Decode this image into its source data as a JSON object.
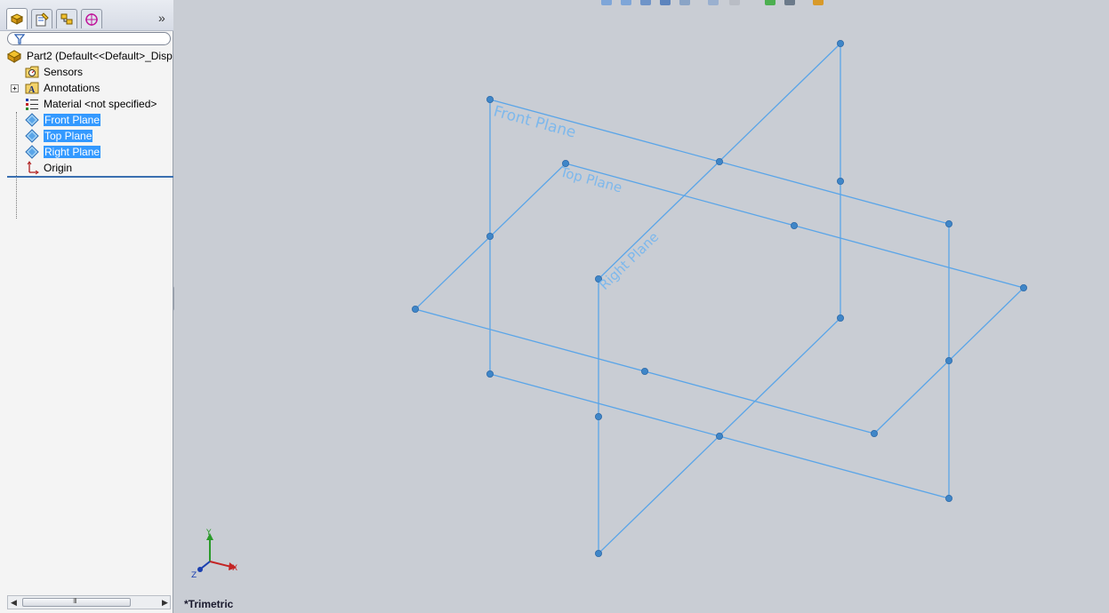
{
  "panel": {
    "tabs": [
      {
        "name": "feature-manager",
        "active": true
      },
      {
        "name": "property-manager",
        "active": false
      },
      {
        "name": "configuration-manager",
        "active": false
      },
      {
        "name": "dim-xpert-manager",
        "active": false
      }
    ],
    "more_symbol": "»",
    "filter_icon": "filter-icon",
    "tree": {
      "root": "Part2  (Default<<Default>_Disp",
      "items": [
        {
          "label": "Sensors",
          "icon": "sensors-icon",
          "selected": false
        },
        {
          "label": "Annotations",
          "icon": "annotations-icon",
          "selected": false,
          "expandable": true
        },
        {
          "label": "Material <not specified>",
          "icon": "material-icon",
          "selected": false
        },
        {
          "label": "Front Plane",
          "icon": "plane-icon",
          "selected": true
        },
        {
          "label": "Top Plane",
          "icon": "plane-icon",
          "selected": true
        },
        {
          "label": "Right Plane",
          "icon": "plane-icon",
          "selected": true
        },
        {
          "label": "Origin",
          "icon": "origin-icon",
          "selected": false
        }
      ]
    },
    "scrollbar_grip": "III"
  },
  "viewport": {
    "view_name": "*Trimetric",
    "plane_labels": {
      "front": "Front Plane",
      "top": "Top Plane",
      "right": "Right Plane"
    },
    "triad": {
      "x": "X",
      "y": "Y",
      "z": "Z"
    },
    "colors": {
      "plane_edge": "#5aa5e8",
      "plane_label": "#7db8ec",
      "selection": "#3399ff",
      "background": "#c9cdd4"
    }
  }
}
